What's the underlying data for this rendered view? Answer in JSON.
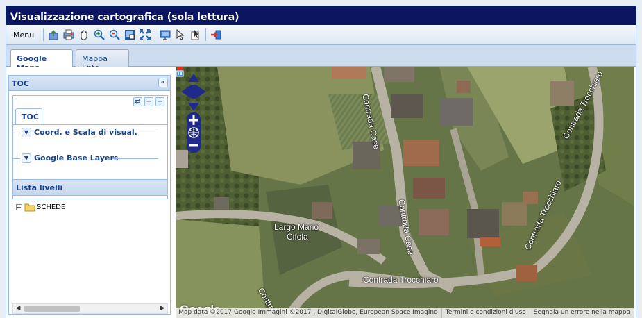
{
  "window": {
    "title": "Visualizzazione cartografica (sola lettura)"
  },
  "toolbar": {
    "menu_label": "Menu",
    "icons": [
      "export-icon",
      "print-icon",
      "pan-hand-icon",
      "zoom-in-icon",
      "zoom-out-icon",
      "zoom-box-icon",
      "full-extent-icon",
      "info-icon",
      "select-pointer-icon",
      "identify-icon",
      "exit-icon"
    ]
  },
  "tabs": [
    {
      "label": "Google Maps",
      "active": true
    },
    {
      "label": "Mappa Ente",
      "active": false
    }
  ],
  "toc": {
    "panel_title": "TOC",
    "collapse_label": "«",
    "inner_tab": "TOC",
    "tool_buttons": [
      "⇄",
      "−",
      "+"
    ],
    "sections": [
      {
        "label": "Coord. e Scala di visual."
      },
      {
        "label": "Google Base Layers"
      }
    ],
    "layers_header": "Lista livelli",
    "tree": [
      {
        "expander": "+",
        "label": "SCHEDE"
      }
    ]
  },
  "map": {
    "logo": "Google",
    "labels": [
      {
        "text": "Contrada Case"
      },
      {
        "text": "Contrada Case"
      },
      {
        "text": "Contrada Trocchiaro"
      },
      {
        "text": "Contrada Trocchiaro"
      },
      {
        "text": "Contrada Trocchiaro"
      },
      {
        "text": "Largo Mario"
      },
      {
        "text": "Cifola"
      },
      {
        "text": "Contra"
      }
    ],
    "attribution": [
      "Map data ©2017 Google Immagini ©2017 , DigitalGlobe, European Space Imaging",
      "Termini e condizioni d'uso",
      "Segnala un errore nella mappa"
    ]
  }
}
